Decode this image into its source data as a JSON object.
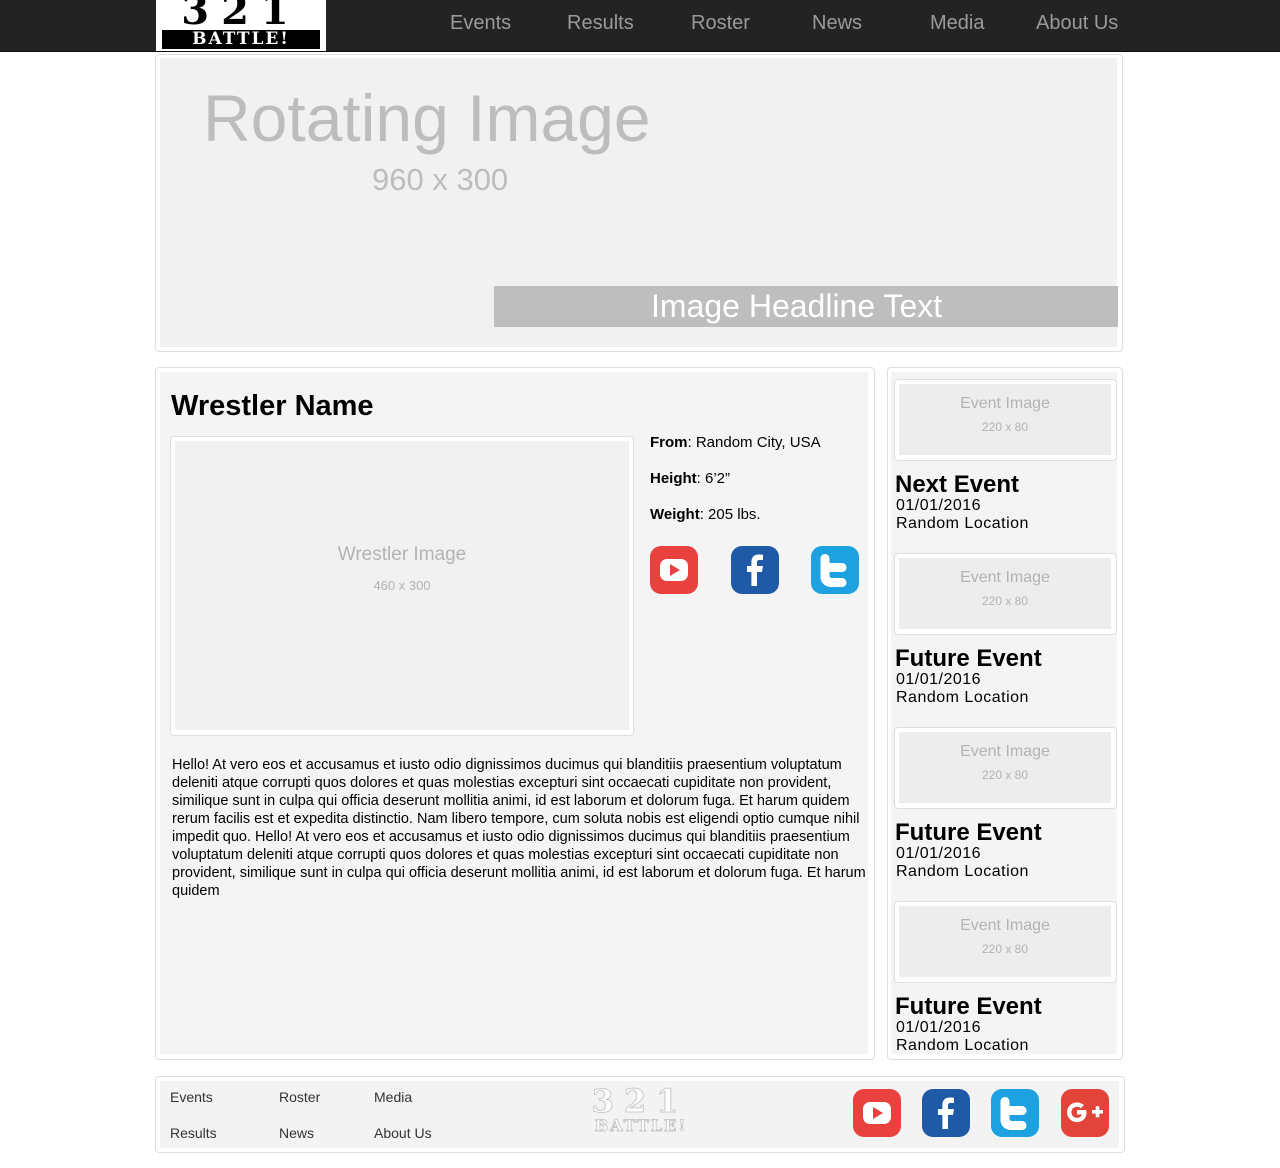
{
  "brand": {
    "logo_top": "321",
    "logo_bottom": "BATTLE!"
  },
  "nav": {
    "items": [
      {
        "label": "Events"
      },
      {
        "label": "Results"
      },
      {
        "label": "Roster"
      },
      {
        "label": "News"
      },
      {
        "label": "Media"
      },
      {
        "label": "About Us"
      }
    ]
  },
  "hero": {
    "title": "Rotating Image",
    "dimensions": "960 x 300",
    "headline": "Image Headline Text"
  },
  "wrestler": {
    "name": "Wrestler Name",
    "image_label": "Wrestler Image",
    "image_dims": "460 x 300",
    "from_label": "From",
    "from_value": ": Random City, USA",
    "height_label": "Height",
    "height_value": ": 6’2”",
    "weight_label": "Weight",
    "weight_value": ": 205 lbs.",
    "social": [
      "youtube-icon",
      "facebook-icon",
      "twitter-icon"
    ],
    "bio": "Hello! At vero eos et accusamus et iusto odio dignissimos ducimus qui blanditiis praesentium voluptatum deleniti atque corrupti quos dolores et quas molestias excepturi sint occaecati cupiditate non provident, similique sunt in culpa qui officia deserunt mollitia animi, id est laborum et dolorum fuga. Et harum quidem rerum facilis est et expedita distinctio. Nam libero tempore, cum soluta nobis est eligendi optio cumque nihil impedit quo. Hello! At vero eos et accusamus et iusto odio dignissimos ducimus qui blanditiis praesentium voluptatum deleniti atque corrupti quos dolores et quas molestias excepturi sint occaecati cupiditate non provident, similique sunt in culpa qui officia deserunt mollitia animi, id est laborum et dolorum fuga. Et harum quidem"
  },
  "events": [
    {
      "image_label": "Event Image",
      "image_dims": "220 x 80",
      "title": "Next Event",
      "date": "01/01/2016",
      "location": "Random Location"
    },
    {
      "image_label": "Event Image",
      "image_dims": "220 x 80",
      "title": "Future Event",
      "date": "01/01/2016",
      "location": "Random Location"
    },
    {
      "image_label": "Event Image",
      "image_dims": "220 x 80",
      "title": "Future Event",
      "date": "01/01/2016",
      "location": "Random Location"
    },
    {
      "image_label": "Event Image",
      "image_dims": "220 x 80",
      "title": "Future Event",
      "date": "01/01/2016",
      "location": "Random Location"
    }
  ],
  "footer": {
    "links": [
      {
        "label": "Events"
      },
      {
        "label": "Results"
      },
      {
        "label": "Roster"
      },
      {
        "label": "News"
      },
      {
        "label": "Media"
      },
      {
        "label": "About Us"
      }
    ],
    "logo_top": "321",
    "logo_bottom": "BATTLE!",
    "social": [
      "youtube-icon",
      "facebook-icon",
      "twitter-icon",
      "google-plus-icon"
    ]
  },
  "colors": {
    "topbar": "#232323",
    "nav_text": "#9a9a9a",
    "panel": "#f1f1f1",
    "youtube": "#e8413e",
    "facebook": "#1f5aa6",
    "twitter": "#1da1e0",
    "google_plus": "#e2443a"
  }
}
